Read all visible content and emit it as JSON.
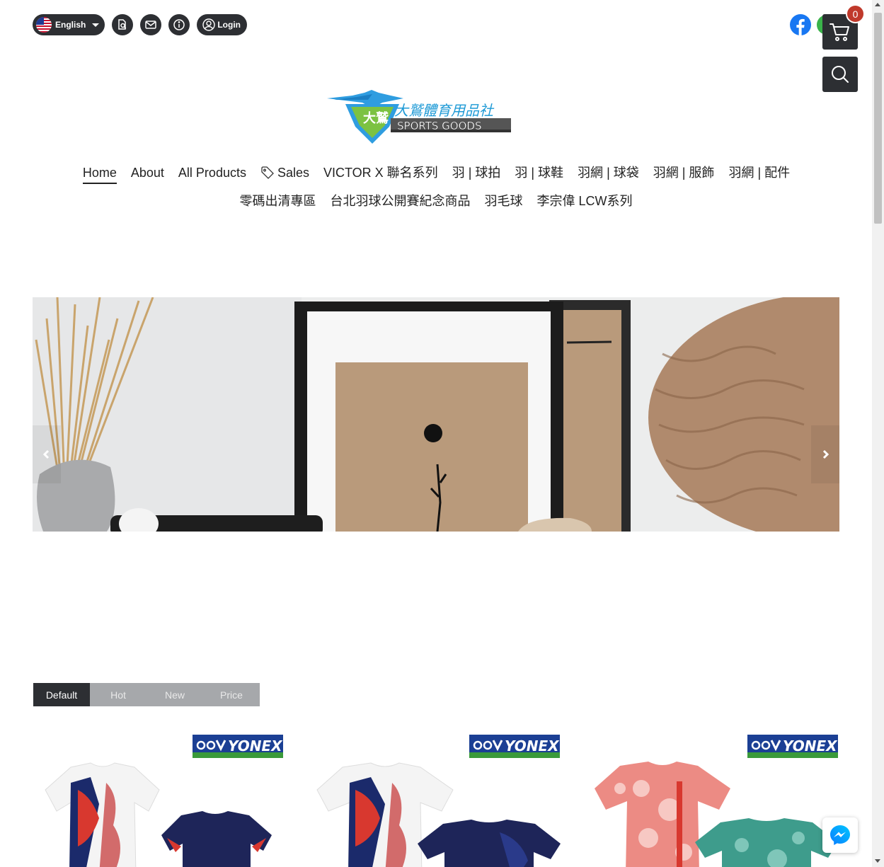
{
  "topbar": {
    "language_label": "English",
    "login_label": "Login",
    "icons": [
      "us-flag-icon",
      "order-search-icon",
      "mail-icon",
      "info-icon",
      "user-icon"
    ]
  },
  "social": {
    "icons": [
      "facebook-icon",
      "line-icon"
    ]
  },
  "cart": {
    "count": "0",
    "icon": "cart-icon"
  },
  "search": {
    "icon": "search-icon"
  },
  "logo": {
    "badge_text": "大鷲",
    "chinese_name": "大鷲體育用品社",
    "english_name": "SPORTS GOODS"
  },
  "nav": {
    "row1": [
      {
        "label": "Home",
        "active": true
      },
      {
        "label": "About"
      },
      {
        "label": "All Products"
      },
      {
        "label": "Sales",
        "icon": "tag-icon"
      },
      {
        "label": "VICTOR X 聯名系列"
      },
      {
        "label": "羽 | 球拍"
      },
      {
        "label": "羽 | 球鞋"
      },
      {
        "label": "羽網 | 球袋"
      },
      {
        "label": "羽網 | 服飾"
      },
      {
        "label": "羽網 | 配件"
      }
    ],
    "row2": [
      {
        "label": "零碼出清專區"
      },
      {
        "label": "台北羽球公開賽紀念商品"
      },
      {
        "label": "羽毛球"
      },
      {
        "label": "李宗偉 LCW系列"
      }
    ]
  },
  "hero": {
    "prev_icon": "chevron-left-icon",
    "next_icon": "chevron-right-icon"
  },
  "sort_tabs": [
    {
      "label": "Default",
      "selected": true
    },
    {
      "label": "Hot"
    },
    {
      "label": "New"
    },
    {
      "label": "Price"
    }
  ],
  "products": [
    {
      "brand": "YONEX"
    },
    {
      "brand": "YONEX"
    },
    {
      "brand": "YONEX"
    }
  ],
  "colors": {
    "dark": "#2d2f33",
    "badge_red": "#c0392b",
    "tab_inactive": "#a6a8ab",
    "yonex_blue": "#1b3f94",
    "yonex_green": "#3a9a3a"
  }
}
